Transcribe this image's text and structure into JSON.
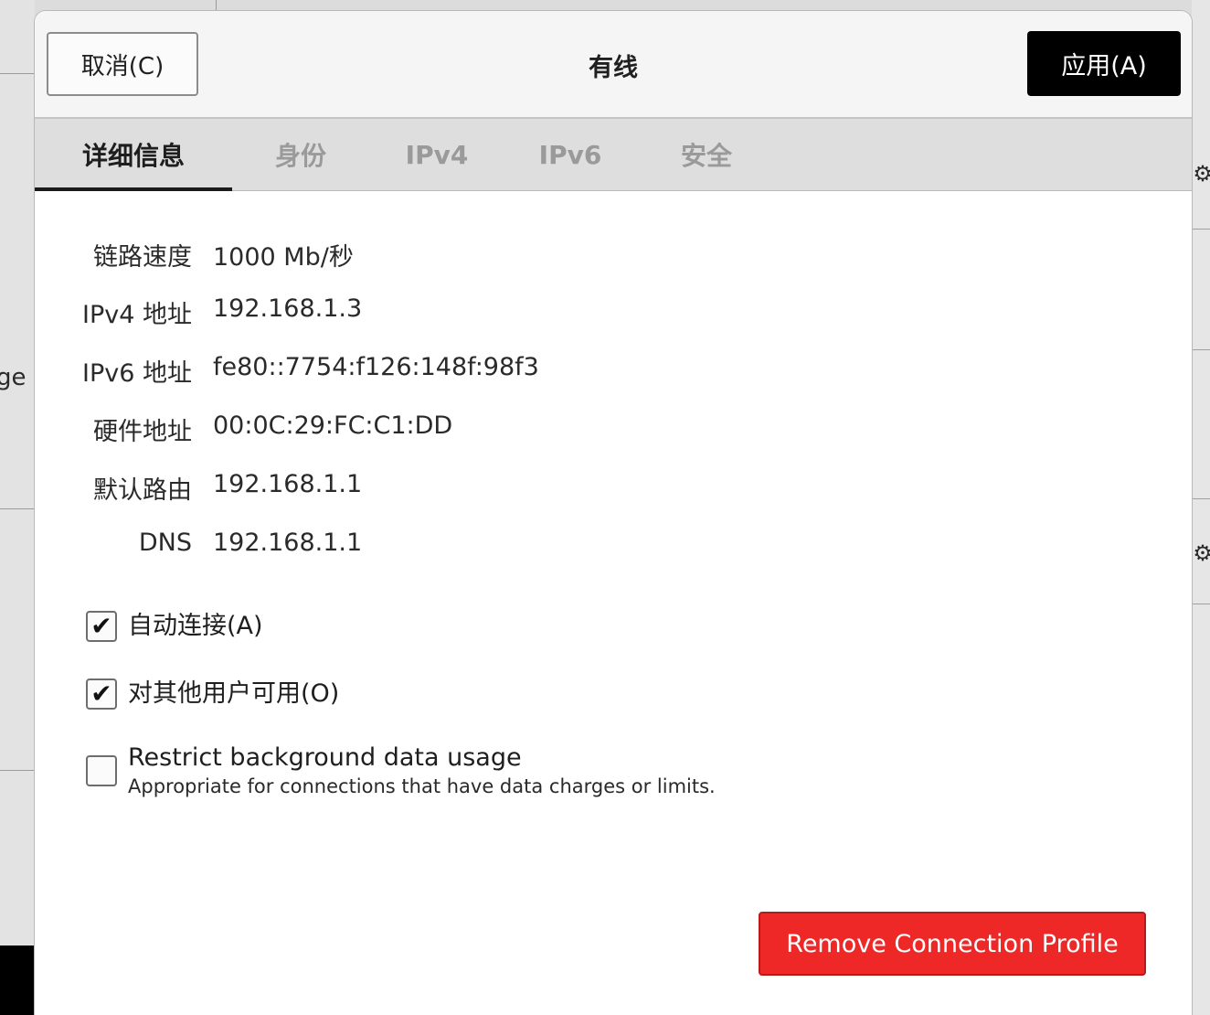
{
  "background": {
    "left_text": "ge"
  },
  "dialog": {
    "cancel_label": "取消(C)",
    "title": "有线",
    "apply_label": "应用(A)",
    "tabs": [
      {
        "label": "详细信息",
        "active": true
      },
      {
        "label": "身份",
        "active": false
      },
      {
        "label": "IPv4",
        "active": false
      },
      {
        "label": "IPv6",
        "active": false
      },
      {
        "label": "安全",
        "active": false
      }
    ],
    "details": [
      {
        "label": "链路速度",
        "value": "1000 Mb/秒"
      },
      {
        "label": "IPv4 地址",
        "value": "192.168.1.3"
      },
      {
        "label": "IPv6 地址",
        "value": "fe80::7754:f126:148f:98f3"
      },
      {
        "label": "硬件地址",
        "value": "00:0C:29:FC:C1:DD"
      },
      {
        "label": "默认路由",
        "value": "192.168.1.1"
      },
      {
        "label": "DNS",
        "value": "192.168.1.1"
      }
    ],
    "options": [
      {
        "label": "自动连接(A)",
        "checked": true
      },
      {
        "label": "对其他用户可用(O)",
        "checked": true
      },
      {
        "label": "Restrict background data usage",
        "description": "Appropriate for connections that have data charges or limits.",
        "checked": false
      }
    ],
    "remove_label": "Remove Connection Profile"
  },
  "colors": {
    "apply_bg": "#000000",
    "remove_bg": "#ee2727"
  }
}
